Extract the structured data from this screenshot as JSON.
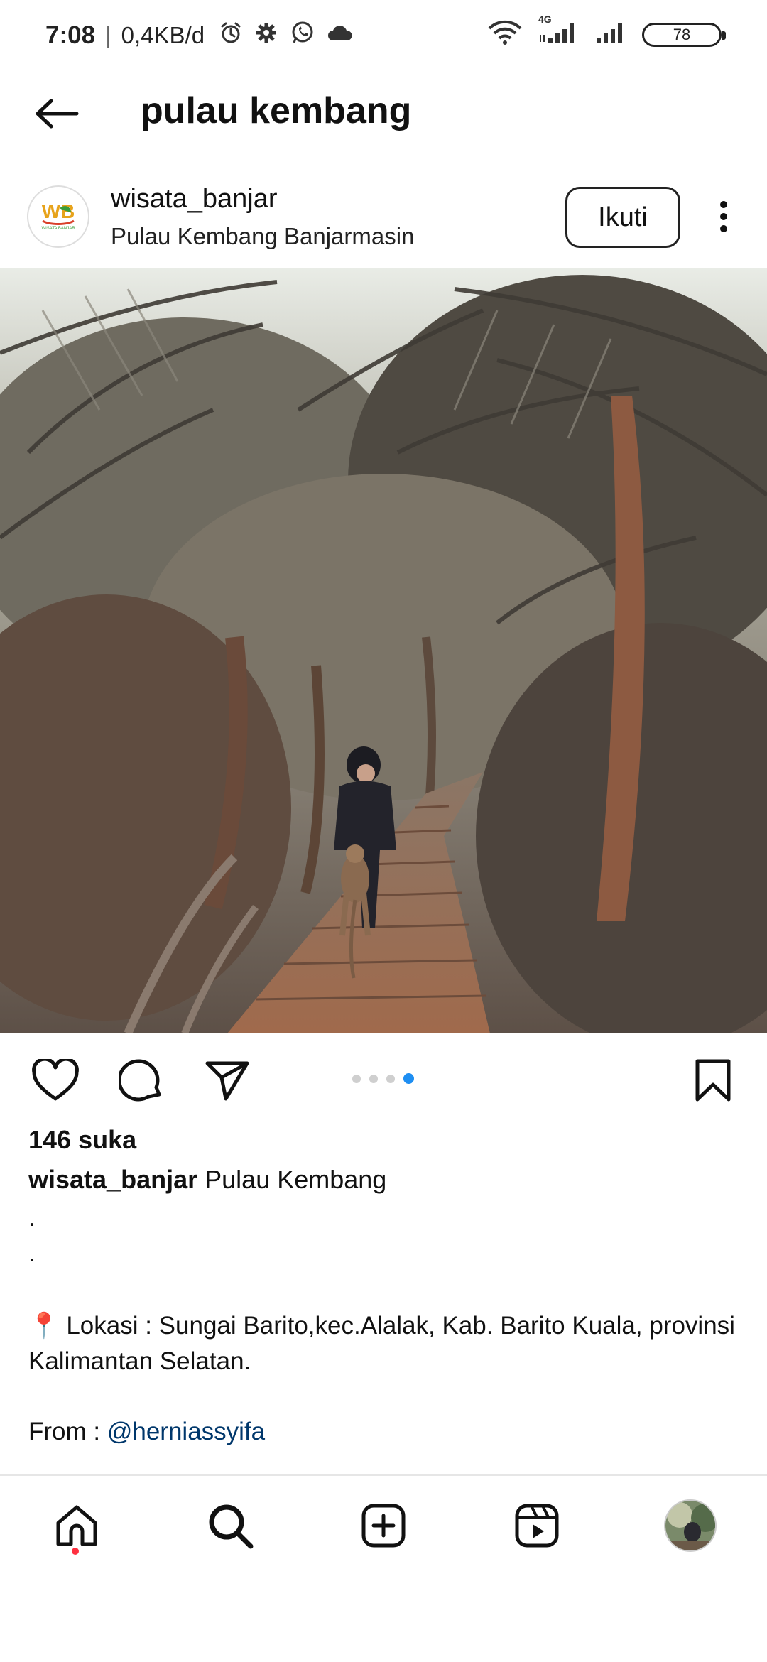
{
  "status_bar": {
    "time": "7:08",
    "network_speed": "0,4KB/d",
    "icons": [
      "alarm-icon",
      "gear-icon",
      "whatsapp-icon",
      "cloud-icon"
    ],
    "right_icons": [
      "wifi-icon",
      "signal-4g-icon",
      "signal-icon"
    ],
    "network_type": "4G",
    "battery_level": "78"
  },
  "header": {
    "title": "pulau kembang",
    "back_icon": "arrow-left-icon"
  },
  "post": {
    "author": "wisata_banjar",
    "location": "Pulau Kembang Banjarmasin",
    "follow_label": "Ikuti",
    "avatar_text": "WB",
    "avatar_subtext": "WISATA BANJAR",
    "carousel": {
      "count": 4,
      "active_index": 3
    },
    "likes": "146 suka",
    "caption_user": "wisata_banjar",
    "caption_title": "Pulau Kembang",
    "caption_dots": [
      ".",
      "."
    ],
    "location_pin": "📍",
    "location_text": "Lokasi : Sungai Barito,kec.Alalak, Kab. Barito Kuala, provinsi Kalimantan Selatan.",
    "from_label": "From :",
    "mention": "@herniassyifa"
  },
  "bottom_nav": {
    "items": [
      "home-icon",
      "search-icon",
      "new-post-icon",
      "reels-icon",
      "profile-avatar"
    ]
  },
  "colors": {
    "accent_blue": "#1e8ef2",
    "mention": "#00376b",
    "notification": "#ff3040"
  }
}
